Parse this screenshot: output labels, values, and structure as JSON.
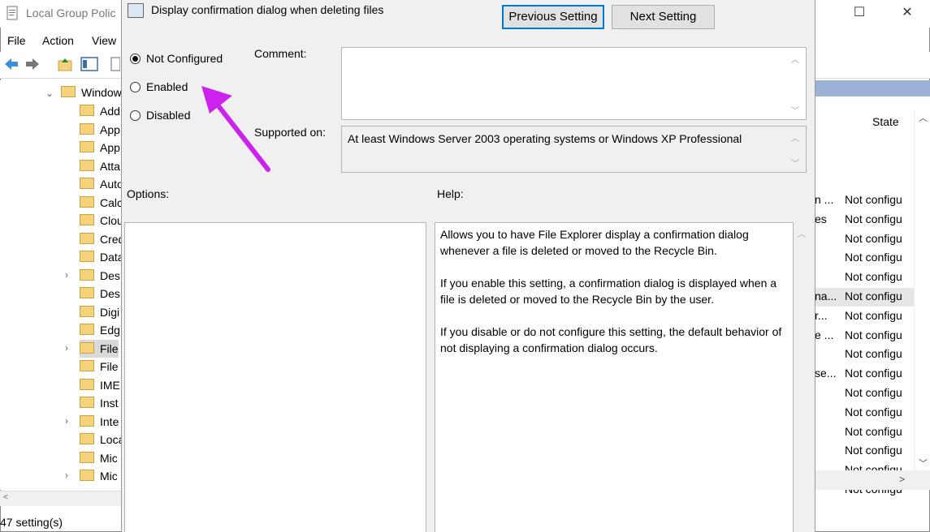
{
  "background_window": {
    "title": "Local Group Polic",
    "menu": [
      "File",
      "Action",
      "View"
    ],
    "tree_root": "Window",
    "tree_items": [
      "Add",
      "App",
      "App",
      "Atta",
      "Auto",
      "Calc",
      "Clou",
      "Cred",
      "Data",
      "Des",
      "Des",
      "Digi",
      "Edg",
      "File",
      "File",
      "IME",
      "Inst",
      "Inte",
      "Loca",
      "Mic",
      "Mic"
    ],
    "status": "47 setting(s)",
    "state_header": "State",
    "state_values": [
      "Not configu",
      "Not configu",
      "Not configu",
      "Not configu",
      "Not configu",
      "Not configu",
      "Not configu",
      "Not configu",
      "Not configu",
      "Not configu",
      "Not configu",
      "Not configu",
      "Not configu",
      "Not configu",
      "Not configu",
      "Not configu"
    ],
    "setting_fragments": [
      "n ...",
      "es",
      "",
      "",
      "",
      "na...",
      "r...",
      "e ...",
      "",
      "se...",
      "",
      "",
      "",
      "",
      "",
      ""
    ]
  },
  "dialog": {
    "title": "Display confirmation dialog when deleting files",
    "previous_label": "Previous Setting",
    "next_label": "Next Setting",
    "radio_not_configured": "Not Configured",
    "radio_enabled": "Enabled",
    "radio_disabled": "Disabled",
    "comment_label": "Comment:",
    "supported_label": "Supported on:",
    "supported_value": "At least Windows Server 2003 operating systems or Windows XP Professional",
    "options_label": "Options:",
    "help_label": "Help:",
    "help_paragraphs": [
      "Allows you to have File Explorer display a confirmation dialog whenever a file is deleted or moved to the Recycle Bin.",
      "If you enable this setting, a confirmation dialog is displayed when a file is deleted or moved to the Recycle Bin by the user.",
      "If you disable or do not configure this setting, the default behavior of not displaying a confirmation dialog occurs."
    ]
  },
  "annotation": {
    "arrow_color": "#cc22ee"
  }
}
